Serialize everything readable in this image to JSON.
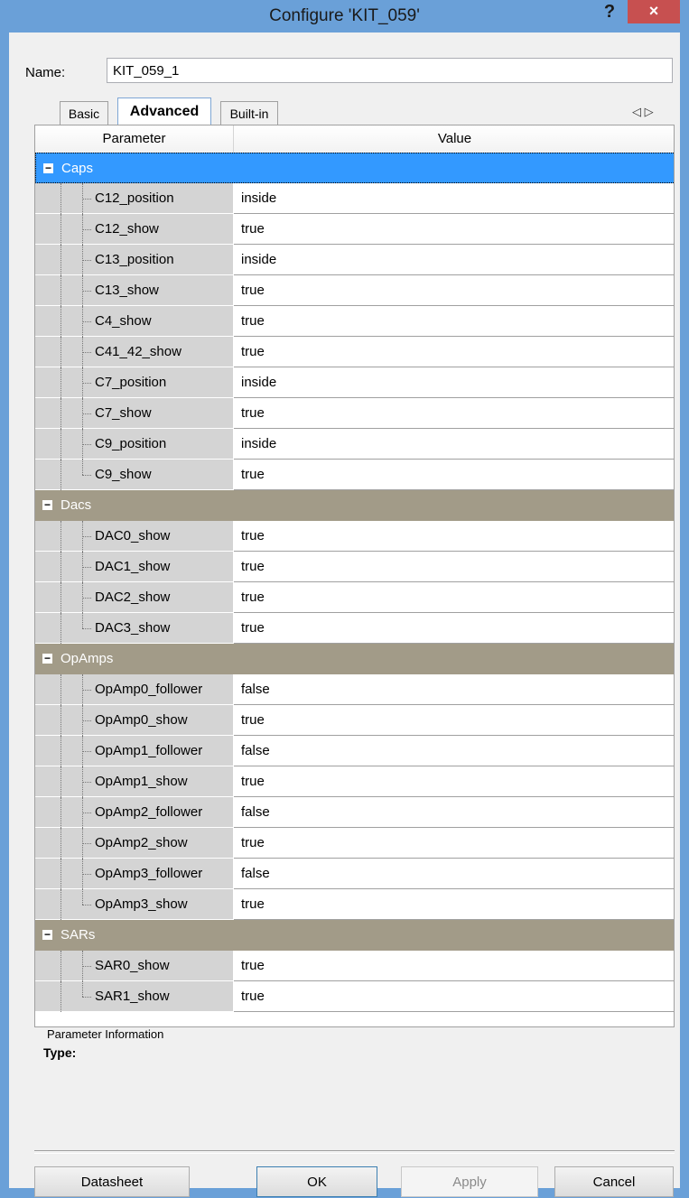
{
  "window": {
    "title": "Configure 'KIT_059'",
    "help_label": "?",
    "close_label": "×"
  },
  "name_field": {
    "label": "Name:",
    "value": "KIT_059_1"
  },
  "tabs": [
    {
      "label": "Basic"
    },
    {
      "label": "Advanced",
      "active": true
    },
    {
      "label": "Built-in"
    }
  ],
  "tab_scroll_label": "◁ ▷",
  "grid": {
    "col_parameter": "Parameter",
    "col_value": "Value",
    "categories": [
      {
        "name": "Caps",
        "toggle": "−",
        "selected": true,
        "rows": [
          {
            "param": "C12_position",
            "value": "inside"
          },
          {
            "param": "C12_show",
            "value": "true"
          },
          {
            "param": "C13_position",
            "value": "inside"
          },
          {
            "param": "C13_show",
            "value": "true"
          },
          {
            "param": "C4_show",
            "value": "true"
          },
          {
            "param": "C41_42_show",
            "value": "true"
          },
          {
            "param": "C7_position",
            "value": "inside"
          },
          {
            "param": "C7_show",
            "value": "true"
          },
          {
            "param": "C9_position",
            "value": "inside"
          },
          {
            "param": "C9_show",
            "value": "true"
          }
        ]
      },
      {
        "name": "Dacs",
        "toggle": "−",
        "rows": [
          {
            "param": "DAC0_show",
            "value": "true"
          },
          {
            "param": "DAC1_show",
            "value": "true"
          },
          {
            "param": "DAC2_show",
            "value": "true"
          },
          {
            "param": "DAC3_show",
            "value": "true"
          }
        ]
      },
      {
        "name": "OpAmps",
        "toggle": "−",
        "rows": [
          {
            "param": "OpAmp0_follower",
            "value": "false"
          },
          {
            "param": "OpAmp0_show",
            "value": "true"
          },
          {
            "param": "OpAmp1_follower",
            "value": "false"
          },
          {
            "param": "OpAmp1_show",
            "value": "true"
          },
          {
            "param": "OpAmp2_follower",
            "value": "false"
          },
          {
            "param": "OpAmp2_show",
            "value": "true"
          },
          {
            "param": "OpAmp3_follower",
            "value": "false"
          },
          {
            "param": "OpAmp3_show",
            "value": "true"
          }
        ]
      },
      {
        "name": "SARs",
        "toggle": "−",
        "rows": [
          {
            "param": "SAR0_show",
            "value": "true"
          },
          {
            "param": "SAR1_show",
            "value": "true"
          }
        ]
      }
    ]
  },
  "info": {
    "title": "Parameter Information",
    "type_label": "Type:"
  },
  "buttons": {
    "datasheet": "Datasheet",
    "ok": "OK",
    "apply": "Apply",
    "cancel": "Cancel"
  }
}
